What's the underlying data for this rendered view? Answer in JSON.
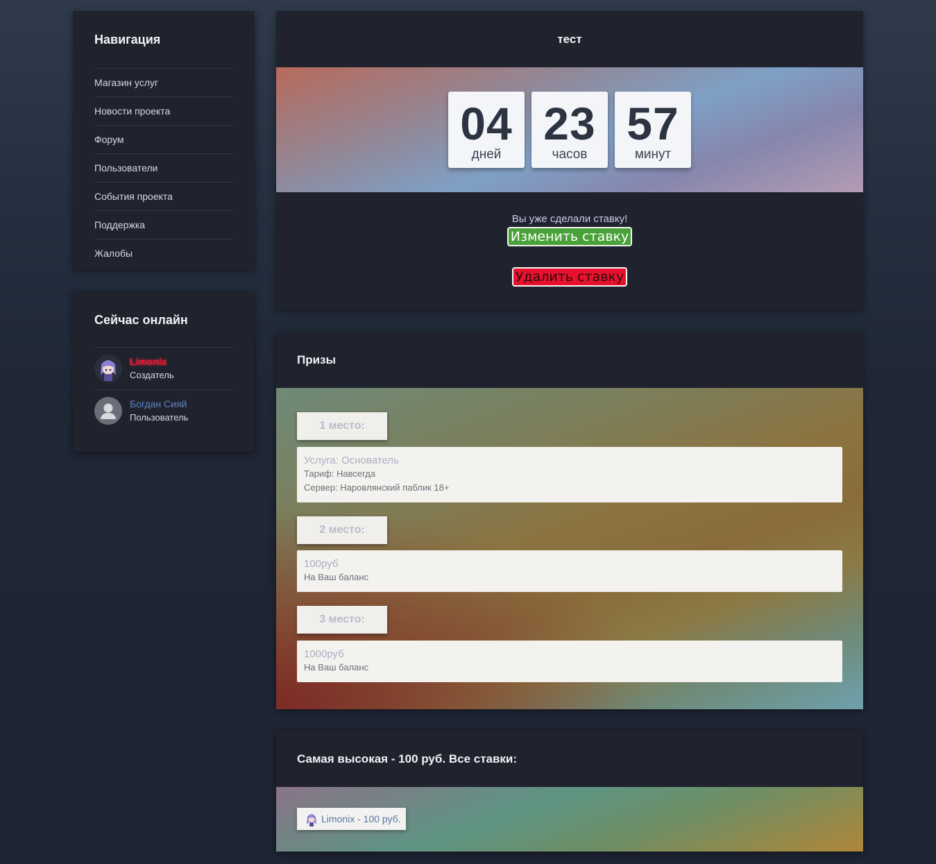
{
  "navigation": {
    "title": "Навигация",
    "items": [
      "Магазин услуг",
      "Новости проекта",
      "Форум",
      "Пользователи",
      "События проекта",
      "Поддержка",
      "Жалобы"
    ]
  },
  "online": {
    "title": "Сейчас онлайн",
    "users": [
      {
        "name": "Limonix",
        "role": "Создатель",
        "avatar": "anime-avatar-icon",
        "color": "#e0192f"
      },
      {
        "name": "Богдан Сияй",
        "role": "Пользователь",
        "avatar": "default-user-icon",
        "color": "#5b86c3"
      }
    ]
  },
  "event": {
    "title": "тест",
    "countdown": [
      {
        "value": "04",
        "label": "дней"
      },
      {
        "value": "23",
        "label": "часов"
      },
      {
        "value": "57",
        "label": "минут"
      }
    ],
    "bet_message": "Вы уже сделали ставку!",
    "change_label": "Изменить ставку",
    "delete_label": "Удалить ставку"
  },
  "prizes": {
    "title": "Призы",
    "items": [
      {
        "place": "1 место:",
        "name": "Услуга: Основатель",
        "lines": [
          "Тариф: Навсегда",
          "Сервер: Наровлянский паблик 18+"
        ]
      },
      {
        "place": "2 место:",
        "name": "100руб",
        "lines": [
          "На Ваш баланс"
        ]
      },
      {
        "place": "3 место:",
        "name": "1000руб",
        "lines": [
          "На Ваш баланс"
        ]
      }
    ]
  },
  "bets": {
    "title": "Самая высокая - 100 руб. Все ставки:",
    "items": [
      {
        "text": "Limonix - 100 руб."
      }
    ]
  },
  "colors": {
    "accent_green": "#4aa13a",
    "accent_red": "#e8112d",
    "panel_bg": "#20222d"
  }
}
